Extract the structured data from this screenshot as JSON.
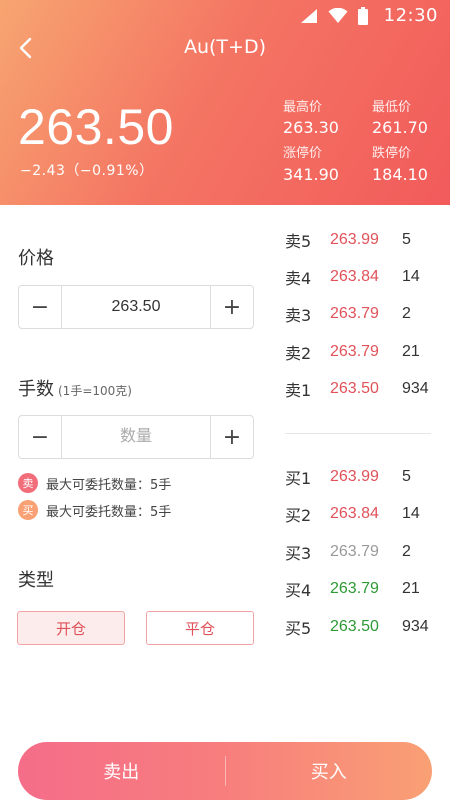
{
  "status_bar": {
    "time": "12:30"
  },
  "header": {
    "title": "Au(T+D)",
    "price": "263.50",
    "change": "−2.43（−0.91%）",
    "stats": [
      {
        "label": "最高价",
        "value": "263.30"
      },
      {
        "label": "最低价",
        "value": "261.70"
      },
      {
        "label": "涨停价",
        "value": "341.90"
      },
      {
        "label": "跌停价",
        "value": "184.10"
      }
    ]
  },
  "order_form": {
    "price_label": "价格",
    "price_value": "263.50",
    "minus": "−",
    "plus": "+",
    "qty_label": "手数",
    "qty_hint": "(1手=100克)",
    "qty_placeholder": "数量",
    "notes": [
      {
        "badge": "卖",
        "text": "最大可委托数量：5手",
        "color": "#f16d7a"
      },
      {
        "badge": "买",
        "text": "最大可委托数量：5手",
        "color": "#f9a074"
      }
    ],
    "type_label": "类型",
    "type_options": [
      "开仓",
      "平仓"
    ],
    "type_selected": "开仓"
  },
  "order_book": {
    "asks": [
      {
        "side": "卖5",
        "price": "263.99",
        "qty": "5",
        "color": "#e0525a"
      },
      {
        "side": "卖4",
        "price": "263.84",
        "qty": "14",
        "color": "#e0525a"
      },
      {
        "side": "卖3",
        "price": "263.79",
        "qty": "2",
        "color": "#e0525a"
      },
      {
        "side": "卖2",
        "price": "263.79",
        "qty": "21",
        "color": "#e0525a"
      },
      {
        "side": "卖1",
        "price": "263.50",
        "qty": "934",
        "color": "#e0525a"
      }
    ],
    "bids": [
      {
        "side": "买1",
        "price": "263.99",
        "qty": "5",
        "color": "#e0525a"
      },
      {
        "side": "买2",
        "price": "263.84",
        "qty": "14",
        "color": "#e0525a"
      },
      {
        "side": "买3",
        "price": "263.79",
        "qty": "2",
        "color": "#999999"
      },
      {
        "side": "买4",
        "price": "263.79",
        "qty": "21",
        "color": "#2e9a35"
      },
      {
        "side": "买5",
        "price": "263.50",
        "qty": "934",
        "color": "#2e9a35"
      }
    ]
  },
  "actions": {
    "sell": "卖出",
    "buy": "买入"
  },
  "colors": {
    "accent": "#f25b5b",
    "up": "#e0525a",
    "down": "#2e9a35",
    "neutral": "#999999"
  }
}
